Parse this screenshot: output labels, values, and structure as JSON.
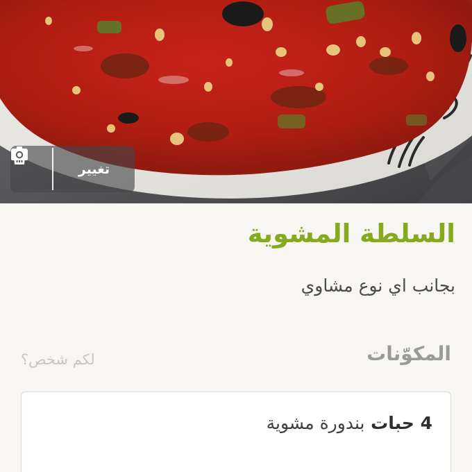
{
  "photo_actions": {
    "change_label": "تغيير",
    "change_icon": "camera-icon",
    "delete_icon": "trash-icon"
  },
  "recipe": {
    "title": "السلطة المشوية",
    "description": "بجانب اي نوع مشاوي"
  },
  "ingredients": {
    "heading": "المكوّنات",
    "servings_prompt": "لكم شخص؟",
    "items": [
      {
        "quantity": "4 حبات",
        "name": "بندورة مشوية"
      }
    ]
  },
  "colors": {
    "accent": "#86aa1e",
    "page_background": "#f8f6f2"
  }
}
